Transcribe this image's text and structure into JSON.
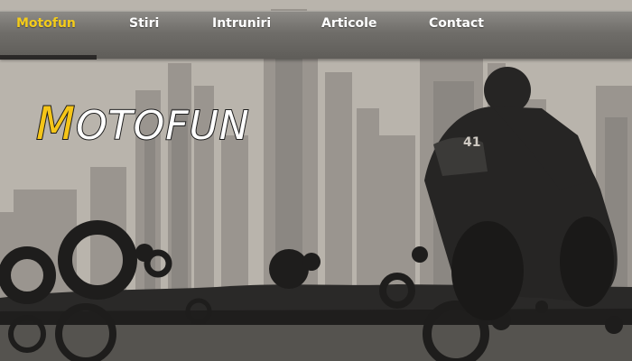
{
  "nav": {
    "items": [
      {
        "label": "Motofun",
        "active": true
      },
      {
        "label": "Stiri",
        "active": false
      },
      {
        "label": "Intruniri",
        "active": false
      },
      {
        "label": "Articole",
        "active": false
      },
      {
        "label": "Contact",
        "active": false
      }
    ],
    "active_color": "#f4cc1b",
    "text_color": "#ffffff"
  },
  "logo": {
    "first_letter": "M",
    "rest": "OTOFUN",
    "first_letter_color": "#f5c518"
  },
  "hero": {
    "rider_number": "41"
  },
  "colors": {
    "background": "#b9b4ac",
    "skyline": "#8e8984",
    "ground": "#1f1e1d"
  }
}
